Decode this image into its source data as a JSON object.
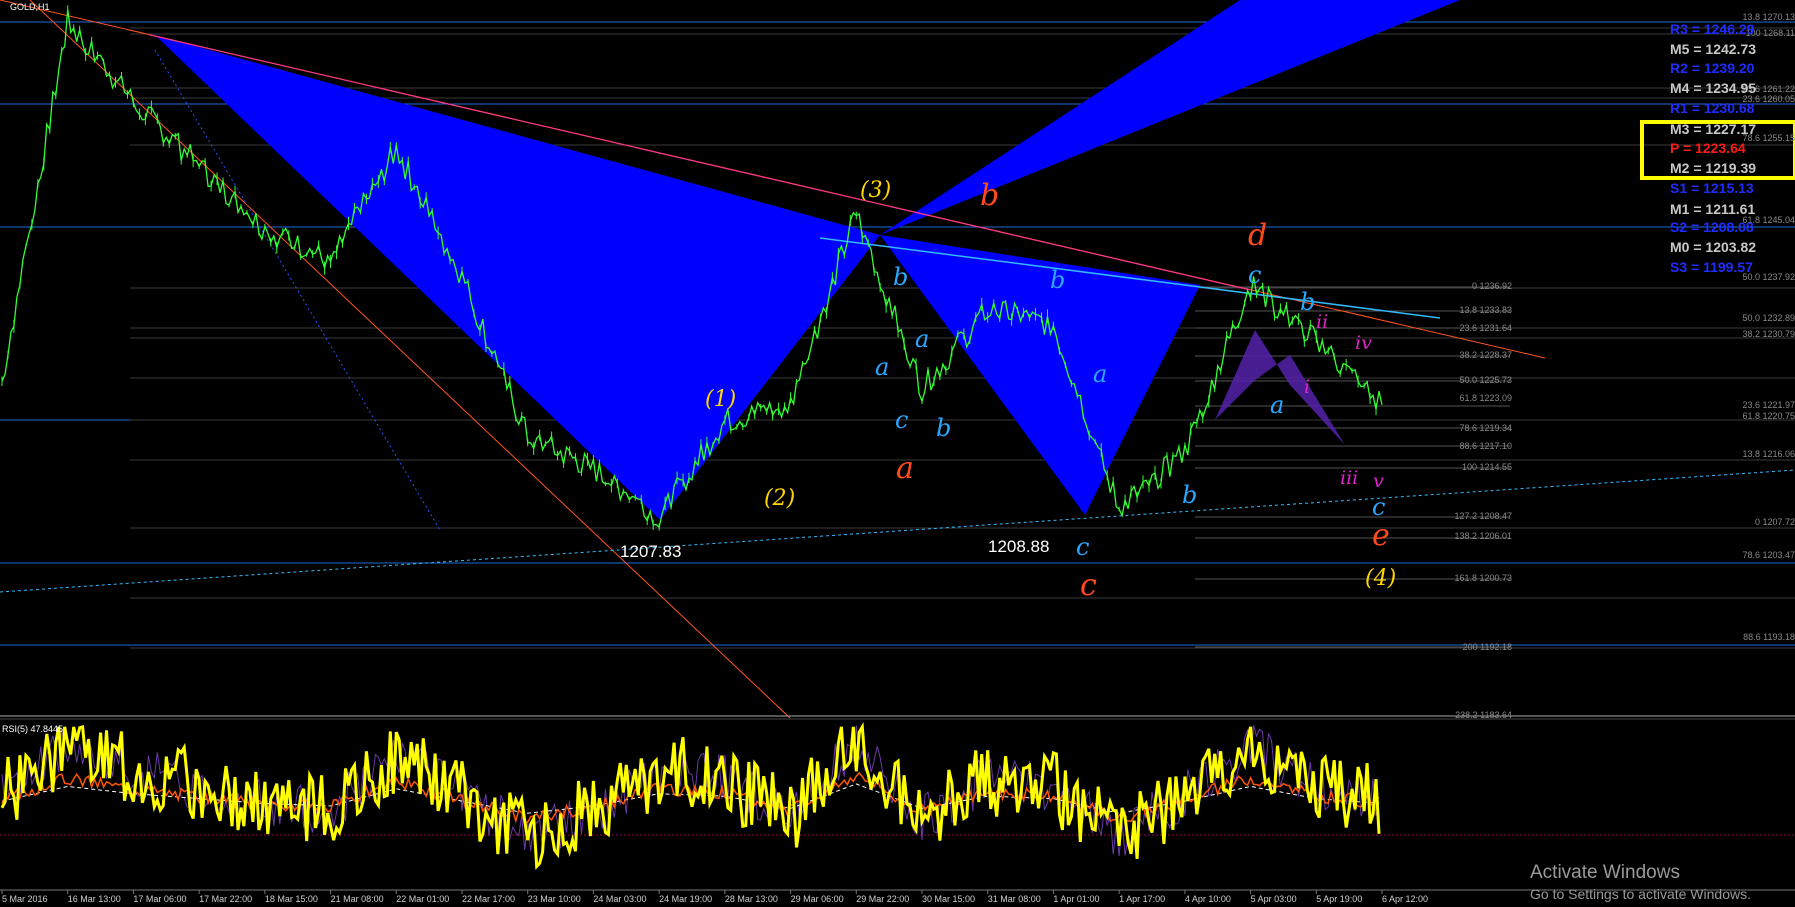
{
  "window": {
    "symbol_label": "GOLD,H1",
    "rsi_label": "RSI(5) 47.8445"
  },
  "time_axis": [
    "5 Mar 2016",
    "16 Mar 13:00",
    "17 Mar 06:00",
    "17 Mar 22:00",
    "18 Mar 15:00",
    "21 Mar 08:00",
    "22 Mar 01:00",
    "22 Mar 17:00",
    "23 Mar 10:00",
    "24 Mar 03:00",
    "24 Mar 19:00",
    "28 Mar 13:00",
    "29 Mar 06:00",
    "29 Mar 22:00",
    "30 Mar 15:00",
    "31 Mar 08:00",
    "1 Apr 01:00",
    "1 Apr 17:00",
    "4 Apr 10:00",
    "5 Apr 03:00",
    "5 Apr 19:00",
    "6 Apr 12:00"
  ],
  "pivots": [
    {
      "text": "R3 = 1246.29",
      "color": "#1e2cff"
    },
    {
      "text": "M5 = 1242.73",
      "color": "#c8c8c8"
    },
    {
      "text": "R2 = 1239.20",
      "color": "#1e2cff"
    },
    {
      "text": "M4 = 1234.95",
      "color": "#c8c8c8"
    },
    {
      "text": "R1 = 1230.68",
      "color": "#1e2cff"
    },
    {
      "text": "M3 = 1227.17",
      "color": "#c8c8c8"
    },
    {
      "text": "P  = 1223.64",
      "color": "#ff1a1a"
    },
    {
      "text": "M2 = 1219.39",
      "color": "#c8c8c8"
    },
    {
      "text": "S1 = 1215.13",
      "color": "#1e2cff"
    },
    {
      "text": "M1 = 1211.61",
      "color": "#c8c8c8"
    },
    {
      "text": "S2 = 1208.08",
      "color": "#1e2cff"
    },
    {
      "text": "M0 = 1203.82",
      "color": "#c8c8c8"
    },
    {
      "text": "S3 = 1199.57",
      "color": "#1e2cff"
    }
  ],
  "fib_labels_center": [
    "0 1236.92",
    "13.8 1233.83",
    "23.6 1231.64",
    "38.2 1228.37",
    "50.0 1225.73",
    "61.8 1223.09",
    "78.6 1219.34",
    "88.6 1217.10",
    "100 1214.55",
    "127.2 1208.47",
    "138.2 1206.01",
    "161.8 1200.73",
    "200 1192.18",
    "238.2 1183.64"
  ],
  "fib_labels_right": [
    "13.8 1270.13",
    "100 1268.11",
    "23.6 1261.22",
    "23.6 1260.05",
    "78.6 1255.15",
    "61.8 1245.04",
    "50.0 1237.92",
    "50.0 1232.89",
    "38.2 1230.79",
    "23.6 1221.97",
    "61.8 1220.75",
    "13.8 1216.06",
    "0 1207.72",
    "78.6 1203.47",
    "88.6 1193.18"
  ],
  "price_labels": [
    "1207.83",
    "1208.88"
  ],
  "wave_labels": {
    "yellow": [
      "(3)",
      "(1)",
      "(2)",
      "(4)"
    ],
    "red": [
      "b",
      "d",
      "a",
      "c",
      "e"
    ],
    "cyan": [
      "b",
      "a",
      "a",
      "c",
      "b",
      "b",
      "a",
      "c",
      "c",
      "b",
      "a",
      "b",
      "c"
    ],
    "magenta": [
      "ii",
      "iv",
      "i",
      "iii",
      "v"
    ]
  },
  "colors": {
    "background": "#000000",
    "candle": "#33ff33",
    "harmonic_fill": "#0000ff",
    "pivot_box": "#ffff00",
    "rsi_main": "#ffff00",
    "rsi_signal": "#ff5500"
  },
  "watermark": {
    "title": "Activate Windows",
    "subtitle": "Go to Settings to activate Windows."
  },
  "chart_data": {
    "type": "line",
    "title": "GOLD,H1",
    "x": [
      "5 Mar 2016",
      "16 Mar 13:00",
      "17 Mar 06:00",
      "17 Mar 22:00",
      "18 Mar 15:00",
      "21 Mar 08:00",
      "22 Mar 01:00",
      "22 Mar 17:00",
      "23 Mar 10:00",
      "24 Mar 03:00",
      "24 Mar 19:00",
      "28 Mar 13:00",
      "29 Mar 06:00",
      "29 Mar 22:00",
      "30 Mar 15:00",
      "31 Mar 08:00",
      "1 Apr 01:00",
      "1 Apr 17:00",
      "4 Apr 10:00",
      "5 Apr 03:00",
      "5 Apr 19:00",
      "6 Apr 12:00"
    ],
    "ylim": [
      1183,
      1271
    ],
    "series": [
      {
        "values": [
          1225,
          1270,
          1260,
          1252,
          1244,
          1240,
          1254,
          1238,
          1218,
          1214,
          1208,
          1220,
          1222,
          1246,
          1224,
          1234,
          1232,
          1209,
          1216,
          1237,
          1230,
          1222
        ]
      }
    ],
    "rsi": {
      "period": 5,
      "current": 47.8445,
      "values": [
        55,
        85,
        70,
        60,
        50,
        45,
        80,
        55,
        30,
        45,
        70,
        65,
        40,
        90,
        40,
        65,
        60,
        30,
        55,
        85,
        60,
        50
      ]
    }
  }
}
